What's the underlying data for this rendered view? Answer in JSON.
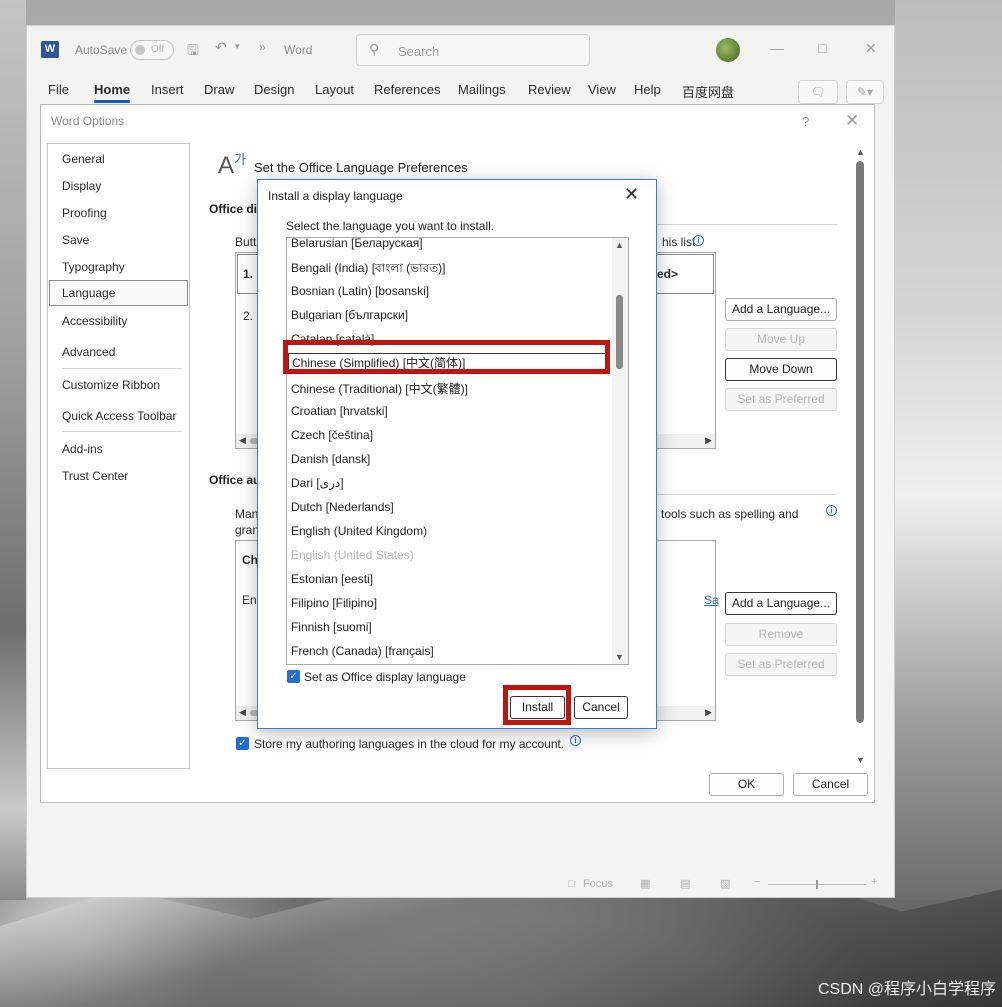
{
  "word": {
    "autosave_label": "AutoSave",
    "autosave_state": "Off",
    "app_name": "Word",
    "search_placeholder": "Search",
    "ribbon_tabs": [
      "File",
      "Home",
      "Insert",
      "Draw",
      "Design",
      "Layout",
      "References",
      "Mailings",
      "Review",
      "View",
      "Help",
      "百度网盘"
    ],
    "active_tab": "Home",
    "status_focus": "Focus"
  },
  "options": {
    "title": "Word Options",
    "help": "?",
    "nav": [
      "General",
      "Display",
      "Proofing",
      "Save",
      "Typography",
      "Language",
      "Accessibility",
      "Advanced",
      "Customize Ribbon",
      "Quick Access Toolbar",
      "Add-ins",
      "Trust Center"
    ],
    "selected_nav": "Language",
    "header_title": "Set the Office Language Preferences",
    "display_section": "Office di",
    "display_intro": "Butt",
    "display_intro_tail": "his list.",
    "display_list": [
      "1.",
      "2."
    ],
    "display_col_tail": "ed>",
    "display_buttons": {
      "add": "Add a Language...",
      "move_up": "Move Up",
      "move_down": "Move Down",
      "set_preferred": "Set as Preferred"
    },
    "authoring_section": "Office au",
    "authoring_intro_1": "Man",
    "authoring_intro_2": "gran",
    "authoring_intro_tail": "tools such as spelling and",
    "authoring_list_header": "Ch",
    "authoring_list_row": "Eng",
    "authoring_link": "Sa",
    "authoring_buttons": {
      "add": "Add a Language...",
      "remove": "Remove",
      "set_preferred": "Set as Preferred"
    },
    "cloud_checkbox_label": "Store my authoring languages in the cloud for my account.",
    "ok": "OK",
    "cancel": "Cancel"
  },
  "install_dialog": {
    "title": "Install a display language",
    "prompt": "Select the language you want to install.",
    "languages": [
      {
        "label": "Belarusian [Беларуская]",
        "state": "normal"
      },
      {
        "label": "Bengali (India) [বাংলা (ভারত)]",
        "state": "normal"
      },
      {
        "label": "Bosnian (Latin) [bosanski]",
        "state": "normal"
      },
      {
        "label": "Bulgarian [български]",
        "state": "normal"
      },
      {
        "label": "Catalan [català]",
        "state": "normal"
      },
      {
        "label": "Chinese (Simplified) [中文(简体)]",
        "state": "selected"
      },
      {
        "label": "Chinese (Traditional) [中文(繁體)]",
        "state": "normal"
      },
      {
        "label": "Croatian [hrvatski]",
        "state": "normal"
      },
      {
        "label": "Czech [čeština]",
        "state": "normal"
      },
      {
        "label": "Danish [dansk]",
        "state": "normal"
      },
      {
        "label": "Dari [دری]",
        "state": "normal"
      },
      {
        "label": "Dutch [Nederlands]",
        "state": "normal"
      },
      {
        "label": "English (United Kingdom)",
        "state": "normal"
      },
      {
        "label": "English (United States)",
        "state": "disabled"
      },
      {
        "label": "Estonian [eesti]",
        "state": "normal"
      },
      {
        "label": "Filipino [Filipino]",
        "state": "normal"
      },
      {
        "label": "Finnish [suomi]",
        "state": "normal"
      },
      {
        "label": "French (Canada) [français]",
        "state": "normal"
      }
    ],
    "set_display_checkbox": "Set as Office display language",
    "install_button": "Install",
    "cancel_button": "Cancel"
  },
  "watermark": "CSDN @程序小白学程序",
  "colors": {
    "accent": "#185abd",
    "link": "#1e6fd9",
    "highlight_box": "#c0150f"
  }
}
